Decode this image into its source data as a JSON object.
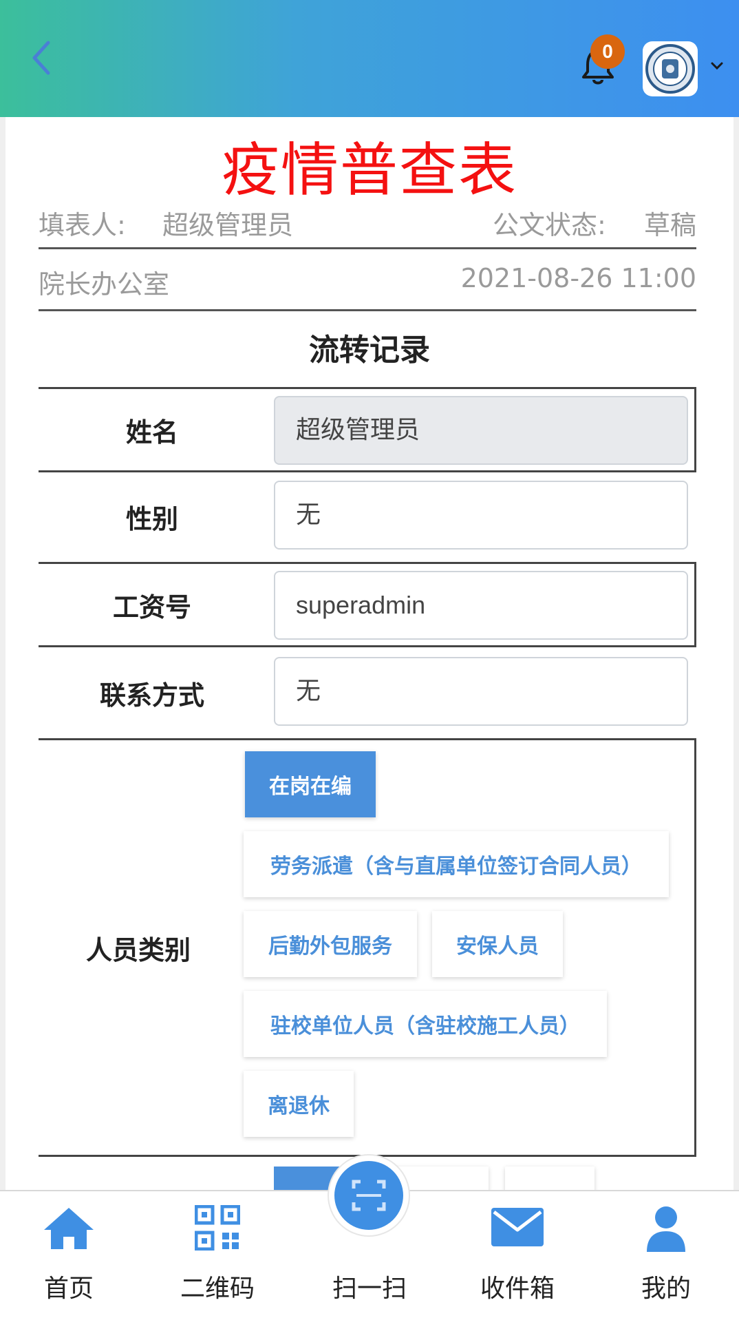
{
  "header": {
    "notification_count": "0",
    "icons": {
      "back": "chevron-left-icon",
      "bell": "bell-icon",
      "caret": "chevron-down-icon",
      "avatar": "university-seal-logo"
    },
    "colors": {
      "gradient_start": "#3cbf9b",
      "gradient_end": "#3d8ff0",
      "badge": "#d9660f"
    }
  },
  "document": {
    "title": "疫情普查表",
    "filler_label": "填表人:",
    "filler_value": "超级管理员",
    "status_label": "公文状态:",
    "status_value": "草稿",
    "department": "院长办公室",
    "datetime": "2021-08-26 11:00",
    "title_color": "#f41111"
  },
  "section": {
    "title": "流转记录"
  },
  "form": {
    "name_label": "姓名",
    "name_value": "超级管理员",
    "gender_label": "性别",
    "gender_value": "无",
    "payroll_label": "工资号",
    "payroll_value": "superadmin",
    "contact_label": "联系方式",
    "contact_value": "无",
    "category_label": "人员类别",
    "category_options": [
      "在岗在编",
      "劳务派遣（含与直属单位签订合同人员）",
      "后勤外包服务",
      "安保人员",
      "驻校单位人员（含驻校施工人员）",
      "离退休"
    ],
    "category_selected": "在岗在编",
    "accent_color": "#4a90dc"
  },
  "bottom_nav": {
    "items": [
      {
        "label": "首页",
        "icon": "home-icon"
      },
      {
        "label": "二维码",
        "icon": "qr-code-icon"
      },
      {
        "label": "扫一扫",
        "icon": "scan-icon"
      },
      {
        "label": "收件箱",
        "icon": "mail-icon"
      },
      {
        "label": "我的",
        "icon": "user-icon"
      }
    ],
    "icon_color": "#3f8fe3"
  }
}
